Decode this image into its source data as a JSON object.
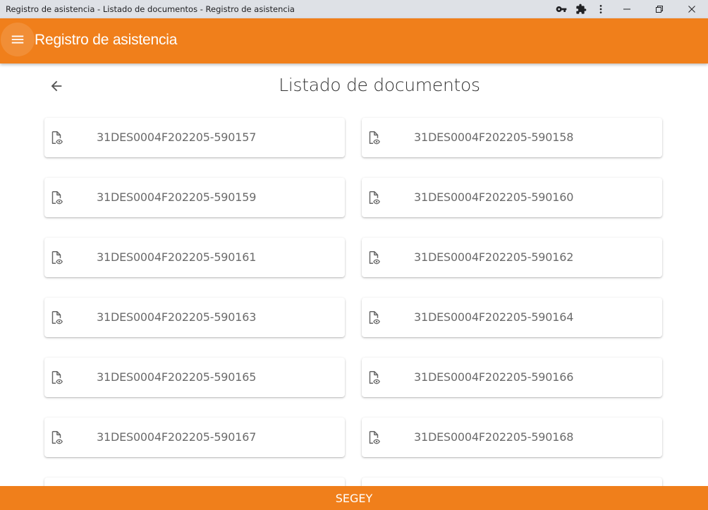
{
  "window": {
    "title": "Registro de asistencia - Listado de documentos - Registro de asistencia"
  },
  "appbar": {
    "title": "Registro de asistencia",
    "menu_icon": "menu-icon",
    "color": "#f07f1b"
  },
  "page": {
    "title": "Listado de documentos",
    "back_icon": "arrow-left-icon"
  },
  "documents": [
    "31DES0004F202205-590157",
    "31DES0004F202205-590158",
    "31DES0004F202205-590159",
    "31DES0004F202205-590160",
    "31DES0004F202205-590161",
    "31DES0004F202205-590162",
    "31DES0004F202205-590163",
    "31DES0004F202205-590164",
    "31DES0004F202205-590165",
    "31DES0004F202205-590166",
    "31DES0004F202205-590167",
    "31DES0004F202205-590168",
    "",
    ""
  ],
  "document_icon": "document-view-icon",
  "footer": {
    "label": "SEGEY"
  }
}
